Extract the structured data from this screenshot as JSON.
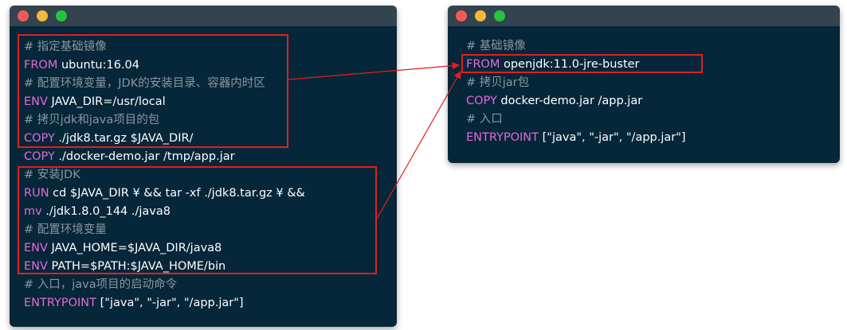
{
  "left_window": {
    "lines": [
      {
        "kind": "comment",
        "text": "# 指定基础镜像"
      },
      {
        "kind": "code",
        "kw": "FROM",
        "rest": " ubuntu:16.04"
      },
      {
        "kind": "comment",
        "text": "# 配置环境变量，JDK的安装目录、容器内时区"
      },
      {
        "kind": "code",
        "kw": "ENV",
        "rest": " JAVA_DIR=/usr/local"
      },
      {
        "kind": "comment",
        "text": "# 拷贝jdk和java项目的包"
      },
      {
        "kind": "code",
        "kw": "COPY",
        "rest": " ./jdk8.tar.gz $JAVA_DIR/"
      },
      {
        "kind": "code",
        "kw": "COPY",
        "rest": " ./docker-demo.jar /tmp/app.jar"
      },
      {
        "kind": "comment",
        "text": "# 安装JDK"
      },
      {
        "kind": "code",
        "kw": "RUN",
        "rest": " cd $JAVA_DIR ¥ && tar -xf ./jdk8.tar.gz ¥ &&"
      },
      {
        "kind": "code",
        "kw": "mv",
        "rest": " ./jdk1.8.0_144 ./java8"
      },
      {
        "kind": "comment",
        "text": "# 配置环境变量"
      },
      {
        "kind": "code",
        "kw": "ENV",
        "rest": " JAVA_HOME=$JAVA_DIR/java8"
      },
      {
        "kind": "code",
        "kw": "ENV",
        "rest": " PATH=$PATH:$JAVA_HOME/bin"
      },
      {
        "kind": "comment",
        "text": "# 入口，java项目的启动命令"
      },
      {
        "kind": "code",
        "kw": "ENTRYPOINT",
        "rest": " [\"java\", \"-jar\", \"/app.jar\"]"
      }
    ]
  },
  "right_window": {
    "lines": [
      {
        "kind": "comment",
        "text": "# 基础镜像"
      },
      {
        "kind": "code",
        "kw": "FROM",
        "rest": " openjdk:11.0-jre-buster"
      },
      {
        "kind": "comment",
        "text": "# 拷贝jar包"
      },
      {
        "kind": "code",
        "kw": "COPY",
        "rest": " docker-demo.jar /app.jar"
      },
      {
        "kind": "comment",
        "text": "# 入口"
      },
      {
        "kind": "code",
        "kw": "ENTRYPOINT",
        "rest": " [\"java\", \"-jar\", \"/app.jar\"]"
      }
    ]
  },
  "colors": {
    "window_bg": "#062639",
    "titlebar": "#33444e",
    "keyword": "#e06cd6",
    "comment": "#8a96a0",
    "highlight": "#e0201f"
  }
}
